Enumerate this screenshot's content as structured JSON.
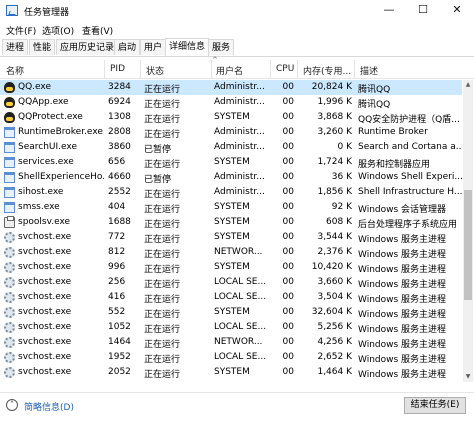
{
  "window": {
    "title": "任务管理器",
    "minimize_glyph": "—",
    "maximize_glyph": "☐",
    "close_glyph": "✕"
  },
  "menu": [
    "文件(F)",
    "选项(O)",
    "查看(V)"
  ],
  "tabs": [
    "进程",
    "性能",
    "应用历史记录",
    "启动",
    "用户",
    "详细信息",
    "服务"
  ],
  "active_tab": "详细信息",
  "columns": {
    "name": "名称",
    "pid": "PID",
    "status": "状态",
    "user": "用户名",
    "cpu": "CPU",
    "mem": "内存(专用...",
    "desc": "描述"
  },
  "sort_indicator": "^",
  "rows": [
    {
      "name": "QQ.exe",
      "pid": "3284",
      "status": "正在运行",
      "user": "Administr...",
      "cpu": "00",
      "mem": "20,824 K",
      "desc": "腾讯QQ",
      "icon": "qq-icon",
      "selected": true
    },
    {
      "name": "QQApp.exe",
      "pid": "6924",
      "status": "正在运行",
      "user": "Administr...",
      "cpu": "00",
      "mem": "1,996 K",
      "desc": "腾讯QQ",
      "icon": "qq-icon"
    },
    {
      "name": "QQProtect.exe",
      "pid": "1308",
      "status": "正在运行",
      "user": "SYSTEM",
      "cpu": "00",
      "mem": "3,868 K",
      "desc": "QQ安全防护进程（Q盾...",
      "icon": "qq-icon"
    },
    {
      "name": "RuntimeBroker.exe",
      "pid": "2808",
      "status": "正在运行",
      "user": "Administr...",
      "cpu": "00",
      "mem": "3,260 K",
      "desc": "Runtime Broker",
      "icon": "window-icon"
    },
    {
      "name": "SearchUI.exe",
      "pid": "3860",
      "status": "已暂停",
      "user": "Administr...",
      "cpu": "00",
      "mem": "0 K",
      "desc": "Search and Cortana a...",
      "icon": "window-icon"
    },
    {
      "name": "services.exe",
      "pid": "656",
      "status": "正在运行",
      "user": "SYSTEM",
      "cpu": "00",
      "mem": "1,724 K",
      "desc": "服务和控制器应用",
      "icon": "window-icon"
    },
    {
      "name": "ShellExperienceHo...",
      "pid": "4660",
      "status": "已暂停",
      "user": "Administr...",
      "cpu": "00",
      "mem": "36 K",
      "desc": "Windows Shell Experi...",
      "icon": "window-icon"
    },
    {
      "name": "sihost.exe",
      "pid": "2552",
      "status": "正在运行",
      "user": "Administr...",
      "cpu": "00",
      "mem": "1,856 K",
      "desc": "Shell Infrastructure H...",
      "icon": "window-icon"
    },
    {
      "name": "smss.exe",
      "pid": "404",
      "status": "正在运行",
      "user": "SYSTEM",
      "cpu": "00",
      "mem": "92 K",
      "desc": "Windows 会话管理器",
      "icon": "window-icon"
    },
    {
      "name": "spoolsv.exe",
      "pid": "1688",
      "status": "正在运行",
      "user": "SYSTEM",
      "cpu": "00",
      "mem": "608 K",
      "desc": "后台处理程序子系统应用",
      "icon": "printer-icon"
    },
    {
      "name": "svchost.exe",
      "pid": "772",
      "status": "正在运行",
      "user": "SYSTEM",
      "cpu": "00",
      "mem": "3,544 K",
      "desc": "Windows 服务主进程",
      "icon": "gear-icon"
    },
    {
      "name": "svchost.exe",
      "pid": "812",
      "status": "正在运行",
      "user": "NETWOR...",
      "cpu": "00",
      "mem": "2,376 K",
      "desc": "Windows 服务主进程",
      "icon": "gear-icon"
    },
    {
      "name": "svchost.exe",
      "pid": "996",
      "status": "正在运行",
      "user": "SYSTEM",
      "cpu": "00",
      "mem": "10,420 K",
      "desc": "Windows 服务主进程",
      "icon": "gear-icon"
    },
    {
      "name": "svchost.exe",
      "pid": "256",
      "status": "正在运行",
      "user": "LOCAL SE...",
      "cpu": "00",
      "mem": "3,660 K",
      "desc": "Windows 服务主进程",
      "icon": "gear-icon"
    },
    {
      "name": "svchost.exe",
      "pid": "416",
      "status": "正在运行",
      "user": "LOCAL SE...",
      "cpu": "00",
      "mem": "3,504 K",
      "desc": "Windows 服务主进程",
      "icon": "gear-icon"
    },
    {
      "name": "svchost.exe",
      "pid": "552",
      "status": "正在运行",
      "user": "SYSTEM",
      "cpu": "00",
      "mem": "32,604 K",
      "desc": "Windows 服务主进程",
      "icon": "gear-icon"
    },
    {
      "name": "svchost.exe",
      "pid": "1052",
      "status": "正在运行",
      "user": "LOCAL SE...",
      "cpu": "00",
      "mem": "5,256 K",
      "desc": "Windows 服务主进程",
      "icon": "gear-icon"
    },
    {
      "name": "svchost.exe",
      "pid": "1464",
      "status": "正在运行",
      "user": "NETWOR...",
      "cpu": "00",
      "mem": "4,256 K",
      "desc": "Windows 服务主进程",
      "icon": "gear-icon"
    },
    {
      "name": "svchost.exe",
      "pid": "1952",
      "status": "正在运行",
      "user": "LOCAL SE...",
      "cpu": "00",
      "mem": "2,652 K",
      "desc": "Windows 服务主进程",
      "icon": "gear-icon"
    },
    {
      "name": "svchost.exe",
      "pid": "2052",
      "status": "正在运行",
      "user": "SYSTEM",
      "cpu": "00",
      "mem": "1,464 K",
      "desc": "Windows 服务主进程",
      "icon": "gear-icon"
    }
  ],
  "footer": {
    "fewer_details": "简略信息(D)",
    "fewer_icon_glyph": "˄",
    "end_task": "结束任务(E)"
  }
}
